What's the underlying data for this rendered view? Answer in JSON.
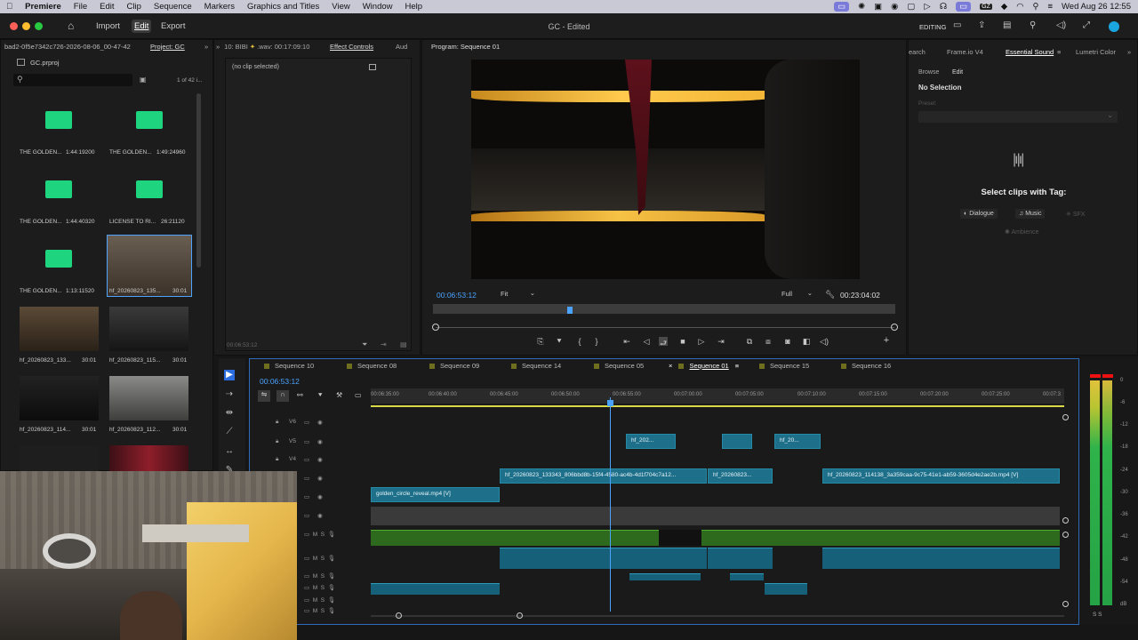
{
  "menubar": {
    "app": "Premiere",
    "items": [
      "File",
      "Edit",
      "Clip",
      "Sequence",
      "Markers",
      "Graphics and Titles",
      "View",
      "Window",
      "Help"
    ],
    "clock": "Wed Aug 26  12:55",
    "badge": "GZ"
  },
  "titlebar": {
    "nav": [
      "Import",
      "Edit",
      "Export"
    ],
    "title": "GC - Edited",
    "workspace": "EDITING"
  },
  "project": {
    "path": "bad2-0f5e7342c726-2026-08-06_00-47-42",
    "tab": "Project: GC",
    "file": "GC.prproj",
    "count": "1 of 42 i...",
    "items": [
      {
        "name": "THE GOLDEN...",
        "dur": "1:44:19200",
        "kind": "audio"
      },
      {
        "name": "THE GOLDEN...",
        "dur": "1:49:24960",
        "kind": "audio"
      },
      {
        "name": "THE GOLDEN...",
        "dur": "1:44:40320",
        "kind": "audio"
      },
      {
        "name": "LICENSE TO RI...",
        "dur": "26:21120",
        "kind": "audio"
      },
      {
        "name": "THE GOLDEN...",
        "dur": "1:13:11520",
        "kind": "audio"
      },
      {
        "name": "hf_20260823_135...",
        "dur": "30:01",
        "kind": "video"
      },
      {
        "name": "hf_20260823_133...",
        "dur": "30:01",
        "kind": "video"
      },
      {
        "name": "hf_20260823_115...",
        "dur": "30:01",
        "kind": "video"
      },
      {
        "name": "hf_20260823_114...",
        "dur": "30:01",
        "kind": "video"
      },
      {
        "name": "hf_20260823_112...",
        "dur": "30:01",
        "kind": "video"
      }
    ]
  },
  "effects": {
    "source_tab": "10: BIBI",
    "source_detail": ".wav: 00:17:09:10",
    "tab": "Effect Controls",
    "tab2": "Aud",
    "no_clip": "(no clip selected)",
    "timecode": "00:06:53:12"
  },
  "program": {
    "tab": "Program: Sequence 01",
    "timecode": "00:06:53:12",
    "fit": "Fit",
    "quality": "Full",
    "duration": "00:23:04:02"
  },
  "essential": {
    "tabs": [
      "earch",
      "Frame.io V4",
      "Essential Sound",
      "Lumetri Color"
    ],
    "sub_tabs": [
      "Browse",
      "Edit"
    ],
    "no_selection": "No Selection",
    "preset_label": "Preset:",
    "heading": "Select clips with Tag:",
    "tags": [
      "Dialogue",
      "Music",
      "SFX",
      "Ambience"
    ]
  },
  "timeline": {
    "sequences": [
      "Sequence 10",
      "Sequence 08",
      "Sequence 09",
      "Sequence 14",
      "Sequence 05",
      "Sequence 01",
      "Sequence 15",
      "Sequence 16"
    ],
    "active": "Sequence 01",
    "timecode": "00:06:53:12",
    "ruler": [
      "00:06:35:00",
      "00:06:40:00",
      "00:06:45:00",
      "00:06:50:00",
      "00:06:55:00",
      "00:07:00:00",
      "00:07:05:00",
      "00:07:10:00",
      "00:07:15:00",
      "00:07:20:00",
      "00:07:25:00",
      "00:07:3"
    ],
    "tracks": [
      "V6",
      "V5",
      "V4"
    ],
    "clips": {
      "v5a": "hf_202...",
      "v5b": "hf_20...",
      "v2a": "hf_20260823_133343_806bbd8b-15f4-4580-ac4b-4d1f704c7a12...",
      "v2b": "hf_20260823...",
      "v2c": "hf_20260823_114138_3a359caa-9c75-41e1-ab59-3605d4e2ae2b.mp4 [V]",
      "v1": "golden_circle_reveal.mp4 [V]"
    }
  },
  "meter": {
    "ticks": [
      "0",
      "-6",
      "-12",
      "-18",
      "-24",
      "-30",
      "-36",
      "-42",
      "-48",
      "-54",
      "dB"
    ],
    "solo": "S  S"
  }
}
